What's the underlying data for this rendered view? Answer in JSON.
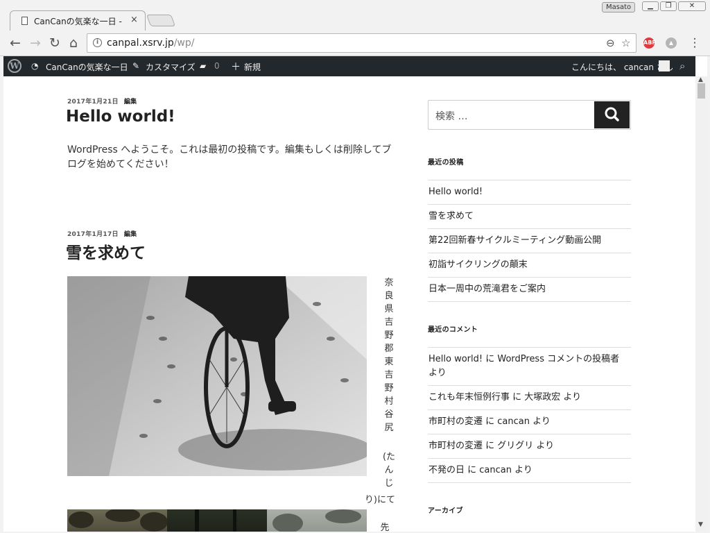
{
  "browser": {
    "tab_title": "CanCanの気楽な一日 -",
    "tab_close": "×",
    "profile": "Masato",
    "url_host": "canpal.xsrv.jp",
    "url_path": "/wp/",
    "ext_badge": "ABP"
  },
  "adminbar": {
    "site": "CanCanの気楽な一日",
    "customize": "カスタマイズ",
    "comments": "0",
    "new": "新規",
    "greeting": "こんにちは、 cancan さん"
  },
  "posts": [
    {
      "date": "2017年1月21日",
      "edit": "編集",
      "title": "Hello world!",
      "excerpt": "WordPress へようこそ。これは最初の投稿です。編集もしくは削除してブログを始めてください！"
    },
    {
      "date": "2017年1月17日",
      "edit": "編集",
      "title": "雪を求めて",
      "vertical_text": [
        "奈",
        "良",
        "県",
        "吉",
        "野",
        "郡",
        "東",
        "吉",
        "野",
        "村",
        "谷",
        "尻",
        "(た",
        "ん",
        "じ"
      ],
      "vertical_tail": "り)にて",
      "vertical_next": "先"
    }
  ],
  "sidebar": {
    "search_placeholder": "検索 …",
    "recent_posts_title": "最近の投稿",
    "recent_posts": [
      "Hello world!",
      "雪を求めて",
      "第22回新春サイクルミーティング動画公開",
      "初詣サイクリングの顛末",
      "日本一周中の荒滝君をご案内"
    ],
    "recent_comments_title": "最近のコメント",
    "recent_comments": [
      "Hello world! に WordPress コメントの投稿者 より",
      "これも年末恒例行事 に 大塚政宏 より",
      "市町村の変遷 に cancan より",
      "市町村の変遷 に グリグリ より",
      "不発の日 に cancan より"
    ],
    "archives_title": "アーカイブ"
  }
}
